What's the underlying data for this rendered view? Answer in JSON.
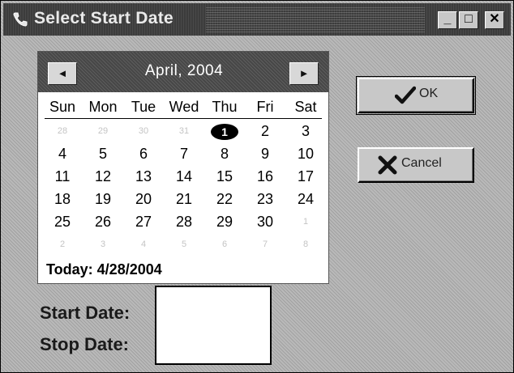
{
  "window": {
    "title": "Select Start Date",
    "controls": {
      "minimize": "_",
      "maximize": "□",
      "close": "✕"
    }
  },
  "calendar": {
    "month_title": "April, 2004",
    "prev_icon": "◄",
    "next_icon": "►",
    "weekdays": [
      "Sun",
      "Mon",
      "Tue",
      "Wed",
      "Thu",
      "Fri",
      "Sat"
    ],
    "weeks": [
      [
        "28",
        "29",
        "30",
        "31",
        "1",
        "2",
        "3"
      ],
      [
        "4",
        "5",
        "6",
        "7",
        "8",
        "9",
        "10"
      ],
      [
        "11",
        "12",
        "13",
        "14",
        "15",
        "16",
        "17"
      ],
      [
        "18",
        "19",
        "20",
        "21",
        "22",
        "23",
        "24"
      ],
      [
        "25",
        "26",
        "27",
        "28",
        "29",
        "30",
        "1"
      ],
      [
        "2",
        "3",
        "4",
        "5",
        "6",
        "7",
        "8"
      ]
    ],
    "other_month": [
      [
        true,
        true,
        true,
        true,
        false,
        false,
        false
      ],
      [
        false,
        false,
        false,
        false,
        false,
        false,
        false
      ],
      [
        false,
        false,
        false,
        false,
        false,
        false,
        false
      ],
      [
        false,
        false,
        false,
        false,
        false,
        false,
        false
      ],
      [
        false,
        false,
        false,
        false,
        false,
        false,
        true
      ],
      [
        true,
        true,
        true,
        true,
        true,
        true,
        true
      ]
    ],
    "selected_day": "1",
    "today_label": "Today: 4/28/2004"
  },
  "buttons": {
    "ok_label": "OK",
    "cancel_label": "Cancel"
  },
  "fields": {
    "start_date_label": "Start Date:",
    "stop_date_label": "Stop Date:",
    "start_date_value": "",
    "stop_date_value": ""
  },
  "icons": {
    "app": "phone-icon",
    "ok": "checkmark-icon",
    "cancel": "x-mark-icon"
  }
}
